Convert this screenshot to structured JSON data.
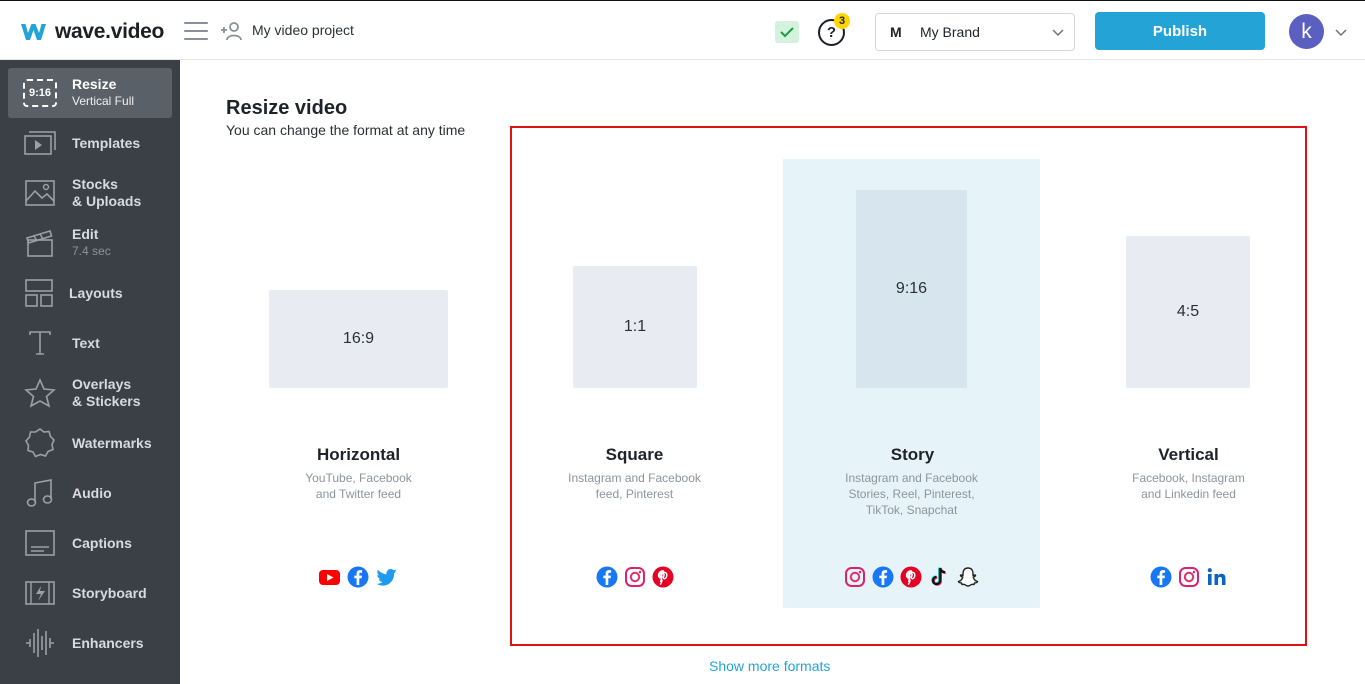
{
  "header": {
    "logo_text": "wave.video",
    "project_name": "My video project",
    "help_count": "3",
    "brand_initial": "M",
    "brand_name": "My Brand",
    "publish_label": "Publish",
    "avatar_letter": "k"
  },
  "sidebar": {
    "items": [
      {
        "label": "Resize",
        "sub": "Vertical Full",
        "badge": "9:16",
        "icon": "resize-icon"
      },
      {
        "label": "Templates",
        "icon": "templates-icon"
      },
      {
        "label": "Stocks",
        "label2": "& Uploads",
        "icon": "image-icon"
      },
      {
        "label": "Edit",
        "sub": "7.4 sec",
        "icon": "clapper-icon"
      },
      {
        "label": "Layouts",
        "icon": "layouts-icon"
      },
      {
        "label": "Text",
        "icon": "text-icon"
      },
      {
        "label": "Overlays",
        "label2": "& Stickers",
        "icon": "star-icon"
      },
      {
        "label": "Watermarks",
        "icon": "watermark-icon"
      },
      {
        "label": "Audio",
        "icon": "music-icon"
      },
      {
        "label": "Captions",
        "icon": "captions-icon"
      },
      {
        "label": "Storyboard",
        "icon": "storyboard-icon"
      },
      {
        "label": "Enhancers",
        "icon": "waveform-icon"
      }
    ]
  },
  "main": {
    "title": "Resize video",
    "subtitle": "You can change the format at any time",
    "show_more": "Show more formats",
    "formats": [
      {
        "ratio": "16:9",
        "name": "Horizontal",
        "desc1": "YouTube, Facebook",
        "desc2": "and Twitter feed",
        "desc3": "",
        "icons": [
          "youtube-icon",
          "facebook-icon",
          "twitter-icon"
        ]
      },
      {
        "ratio": "1:1",
        "name": "Square",
        "desc1": "Instagram and Facebook",
        "desc2": "feed, Pinterest",
        "desc3": "",
        "icons": [
          "facebook-icon",
          "instagram-icon",
          "pinterest-icon"
        ]
      },
      {
        "ratio": "9:16",
        "name": "Story",
        "desc1": "Instagram and Facebook",
        "desc2": "Stories, Reel, Pinterest,",
        "desc3": "TikTok, Snapchat",
        "selected": true,
        "icons": [
          "instagram-icon",
          "facebook-icon",
          "pinterest-icon",
          "tiktok-icon",
          "snapchat-icon"
        ]
      },
      {
        "ratio": "4:5",
        "name": "Vertical",
        "desc1": "Facebook, Instagram",
        "desc2": "and Linkedin feed",
        "desc3": "",
        "icons": [
          "facebook-icon",
          "instagram-icon",
          "linkedin-icon"
        ]
      }
    ]
  },
  "colors": {
    "accent": "#24a4d6",
    "sidebar_bg": "#3b4046",
    "highlight_border": "#e01111",
    "selected_bg": "#e6f4fa"
  }
}
